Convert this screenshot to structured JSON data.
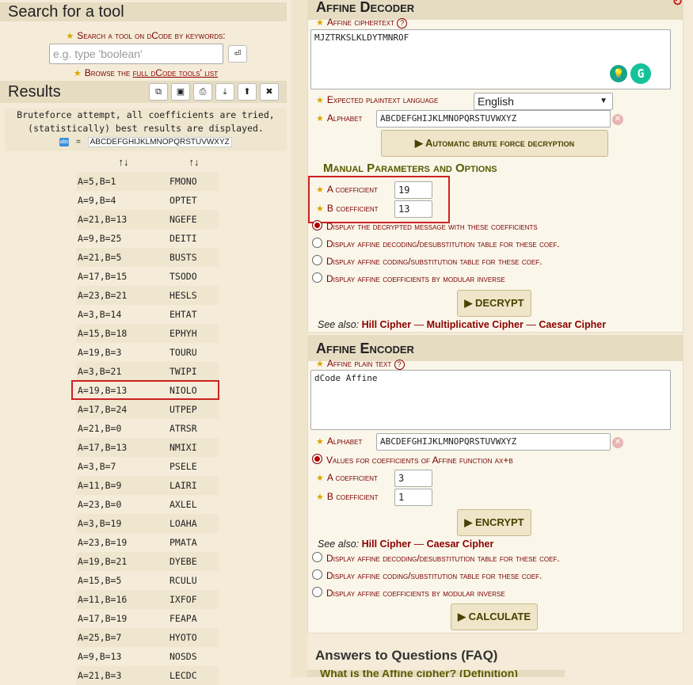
{
  "left": {
    "search_title": "Search for a tool",
    "search_label": "Search a tool on dCode by keywords:",
    "search_placeholder": "e.g. type 'boolean'",
    "browse_prefix": "Browse the ",
    "browse_link": "full dCode tools' list",
    "results_title": "Results",
    "bruteforce_note_1": "Bruteforce attempt, all coefficients are tried,",
    "bruteforce_note_2": "(statistically) best results are displayed.",
    "alphabet_eq": "=",
    "alphabet_value": "ABCDEFGHIJKLMNOPQRSTUVWXYZ",
    "sort_glyph": "↑↓",
    "rows": [
      {
        "coef": "A=5,B=1",
        "text": "FMONO"
      },
      {
        "coef": "A=9,B=4",
        "text": "OPTET"
      },
      {
        "coef": "A=21,B=13",
        "text": "NGEFE"
      },
      {
        "coef": "A=9,B=25",
        "text": "DEITI"
      },
      {
        "coef": "A=21,B=5",
        "text": "BUSTS"
      },
      {
        "coef": "A=17,B=15",
        "text": "TSODO"
      },
      {
        "coef": "A=23,B=21",
        "text": "HESLS"
      },
      {
        "coef": "A=3,B=14",
        "text": "EHTAT"
      },
      {
        "coef": "A=15,B=18",
        "text": "EPHYH"
      },
      {
        "coef": "A=19,B=3",
        "text": "TOURU"
      },
      {
        "coef": "A=3,B=21",
        "text": "TWIPI"
      },
      {
        "coef": "A=19,B=13",
        "text": "NIOLO"
      },
      {
        "coef": "A=17,B=24",
        "text": "UTPEP"
      },
      {
        "coef": "A=21,B=0",
        "text": "ATRSR"
      },
      {
        "coef": "A=17,B=13",
        "text": "NMIXI"
      },
      {
        "coef": "A=3,B=7",
        "text": "PSELE"
      },
      {
        "coef": "A=11,B=9",
        "text": "LAIRI"
      },
      {
        "coef": "A=23,B=0",
        "text": "AXLEL"
      },
      {
        "coef": "A=3,B=19",
        "text": "LOAHA"
      },
      {
        "coef": "A=23,B=19",
        "text": "PMATA"
      },
      {
        "coef": "A=19,B=21",
        "text": "DYEBE"
      },
      {
        "coef": "A=15,B=5",
        "text": "RCULU"
      },
      {
        "coef": "A=11,B=16",
        "text": "IXFOF"
      },
      {
        "coef": "A=17,B=19",
        "text": "FEAPA"
      },
      {
        "coef": "A=25,B=7",
        "text": "HYOTO"
      },
      {
        "coef": "A=9,B=13",
        "text": "NOSDS"
      },
      {
        "coef": "A=21,B=3",
        "text": "LECDC"
      }
    ]
  },
  "decoder": {
    "title": "Affine Decoder",
    "ciphertext_label": "Affine ciphertext",
    "ciphertext_value": "MJZTRKSLKLDYTMNROF",
    "language_label": "Expected plaintext language",
    "language_value": "English",
    "alphabet_label": "Alphabet",
    "alphabet_value": "ABCDEFGHIJKLMNOPQRSTUVWXYZ",
    "bruteforce_button": "Automatic brute force decryption",
    "manual_title": "Manual Parameters and Options",
    "a_label": "A coefficient",
    "a_value": "19",
    "b_label": "B coefficient",
    "b_value": "13",
    "options": [
      "Display the decrypted message with these coefficients",
      "Display affine decoding/desubstitution table for these coef.",
      "Display affine coding/substitution table for these coef.",
      "Display affine coefficients by modular inverse"
    ],
    "decrypt_button": "DECRYPT",
    "see_also": "See also:",
    "links": [
      "Hill Cipher",
      "Multiplicative Cipher",
      "Caesar Cipher"
    ],
    "dash": "—"
  },
  "encoder": {
    "title": "Affine Encoder",
    "plaintext_label": "Affine plain text",
    "plaintext_value": "dCode Affine",
    "alphabet_label": "Alphabet",
    "alphabet_value": "ABCDEFGHIJKLMNOPQRSTUVWXYZ",
    "values_option": "Values for coefficients of Affine function ax+b",
    "a_label": "A coefficient",
    "a_value": "3",
    "b_label": "B coefficient",
    "b_value": "1",
    "encrypt_button": "ENCRYPT",
    "see_also": "See also:",
    "links": [
      "Hill Cipher",
      "Caesar Cipher"
    ],
    "dash": "—",
    "options": [
      "Display affine decoding/desubstitution table for these coef.",
      "Display affine coding/substitution table for these coef.",
      "Display affine coefficients by modular inverse"
    ],
    "calculate_button": "CALCULATE"
  },
  "faq": {
    "title": "Answers to Questions (FAQ)",
    "first_question": "What is the Affine cipher? (Definition)"
  },
  "colors": {
    "highlight_box": "#cc2222",
    "link": "#8b0000",
    "button_text": "#4a4000"
  }
}
